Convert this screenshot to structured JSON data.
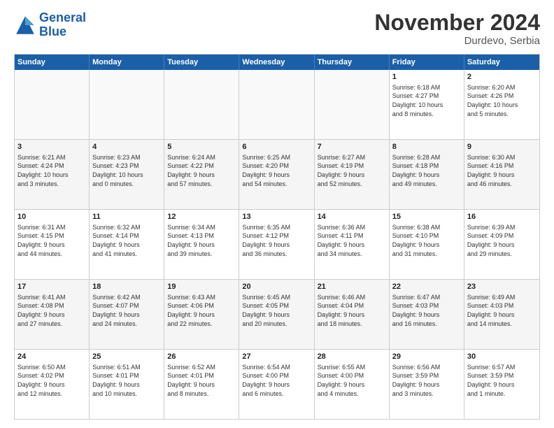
{
  "header": {
    "logo": {
      "line1": "General",
      "line2": "Blue"
    },
    "month": "November 2024",
    "location": "Durdevo, Serbia"
  },
  "weekdays": [
    "Sunday",
    "Monday",
    "Tuesday",
    "Wednesday",
    "Thursday",
    "Friday",
    "Saturday"
  ],
  "rows": [
    {
      "cells": [
        {
          "day": "",
          "info": "",
          "empty": true
        },
        {
          "day": "",
          "info": "",
          "empty": true
        },
        {
          "day": "",
          "info": "",
          "empty": true
        },
        {
          "day": "",
          "info": "",
          "empty": true
        },
        {
          "day": "",
          "info": "",
          "empty": true
        },
        {
          "day": "1",
          "info": "Sunrise: 6:18 AM\nSunset: 4:27 PM\nDaylight: 10 hours\nand 8 minutes.",
          "empty": false
        },
        {
          "day": "2",
          "info": "Sunrise: 6:20 AM\nSunset: 4:26 PM\nDaylight: 10 hours\nand 5 minutes.",
          "empty": false
        }
      ]
    },
    {
      "cells": [
        {
          "day": "3",
          "info": "Sunrise: 6:21 AM\nSunset: 4:24 PM\nDaylight: 10 hours\nand 3 minutes.",
          "empty": false
        },
        {
          "day": "4",
          "info": "Sunrise: 6:23 AM\nSunset: 4:23 PM\nDaylight: 10 hours\nand 0 minutes.",
          "empty": false
        },
        {
          "day": "5",
          "info": "Sunrise: 6:24 AM\nSunset: 4:22 PM\nDaylight: 9 hours\nand 57 minutes.",
          "empty": false
        },
        {
          "day": "6",
          "info": "Sunrise: 6:25 AM\nSunset: 4:20 PM\nDaylight: 9 hours\nand 54 minutes.",
          "empty": false
        },
        {
          "day": "7",
          "info": "Sunrise: 6:27 AM\nSunset: 4:19 PM\nDaylight: 9 hours\nand 52 minutes.",
          "empty": false
        },
        {
          "day": "8",
          "info": "Sunrise: 6:28 AM\nSunset: 4:18 PM\nDaylight: 9 hours\nand 49 minutes.",
          "empty": false
        },
        {
          "day": "9",
          "info": "Sunrise: 6:30 AM\nSunset: 4:16 PM\nDaylight: 9 hours\nand 46 minutes.",
          "empty": false
        }
      ]
    },
    {
      "cells": [
        {
          "day": "10",
          "info": "Sunrise: 6:31 AM\nSunset: 4:15 PM\nDaylight: 9 hours\nand 44 minutes.",
          "empty": false
        },
        {
          "day": "11",
          "info": "Sunrise: 6:32 AM\nSunset: 4:14 PM\nDaylight: 9 hours\nand 41 minutes.",
          "empty": false
        },
        {
          "day": "12",
          "info": "Sunrise: 6:34 AM\nSunset: 4:13 PM\nDaylight: 9 hours\nand 39 minutes.",
          "empty": false
        },
        {
          "day": "13",
          "info": "Sunrise: 6:35 AM\nSunset: 4:12 PM\nDaylight: 9 hours\nand 36 minutes.",
          "empty": false
        },
        {
          "day": "14",
          "info": "Sunrise: 6:36 AM\nSunset: 4:11 PM\nDaylight: 9 hours\nand 34 minutes.",
          "empty": false
        },
        {
          "day": "15",
          "info": "Sunrise: 6:38 AM\nSunset: 4:10 PM\nDaylight: 9 hours\nand 31 minutes.",
          "empty": false
        },
        {
          "day": "16",
          "info": "Sunrise: 6:39 AM\nSunset: 4:09 PM\nDaylight: 9 hours\nand 29 minutes.",
          "empty": false
        }
      ]
    },
    {
      "cells": [
        {
          "day": "17",
          "info": "Sunrise: 6:41 AM\nSunset: 4:08 PM\nDaylight: 9 hours\nand 27 minutes.",
          "empty": false
        },
        {
          "day": "18",
          "info": "Sunrise: 6:42 AM\nSunset: 4:07 PM\nDaylight: 9 hours\nand 24 minutes.",
          "empty": false
        },
        {
          "day": "19",
          "info": "Sunrise: 6:43 AM\nSunset: 4:06 PM\nDaylight: 9 hours\nand 22 minutes.",
          "empty": false
        },
        {
          "day": "20",
          "info": "Sunrise: 6:45 AM\nSunset: 4:05 PM\nDaylight: 9 hours\nand 20 minutes.",
          "empty": false
        },
        {
          "day": "21",
          "info": "Sunrise: 6:46 AM\nSunset: 4:04 PM\nDaylight: 9 hours\nand 18 minutes.",
          "empty": false
        },
        {
          "day": "22",
          "info": "Sunrise: 6:47 AM\nSunset: 4:03 PM\nDaylight: 9 hours\nand 16 minutes.",
          "empty": false
        },
        {
          "day": "23",
          "info": "Sunrise: 6:49 AM\nSunset: 4:03 PM\nDaylight: 9 hours\nand 14 minutes.",
          "empty": false
        }
      ]
    },
    {
      "cells": [
        {
          "day": "24",
          "info": "Sunrise: 6:50 AM\nSunset: 4:02 PM\nDaylight: 9 hours\nand 12 minutes.",
          "empty": false
        },
        {
          "day": "25",
          "info": "Sunrise: 6:51 AM\nSunset: 4:01 PM\nDaylight: 9 hours\nand 10 minutes.",
          "empty": false
        },
        {
          "day": "26",
          "info": "Sunrise: 6:52 AM\nSunset: 4:01 PM\nDaylight: 9 hours\nand 8 minutes.",
          "empty": false
        },
        {
          "day": "27",
          "info": "Sunrise: 6:54 AM\nSunset: 4:00 PM\nDaylight: 9 hours\nand 6 minutes.",
          "empty": false
        },
        {
          "day": "28",
          "info": "Sunrise: 6:55 AM\nSunset: 4:00 PM\nDaylight: 9 hours\nand 4 minutes.",
          "empty": false
        },
        {
          "day": "29",
          "info": "Sunrise: 6:56 AM\nSunset: 3:59 PM\nDaylight: 9 hours\nand 3 minutes.",
          "empty": false
        },
        {
          "day": "30",
          "info": "Sunrise: 6:57 AM\nSunset: 3:59 PM\nDaylight: 9 hours\nand 1 minute.",
          "empty": false
        }
      ]
    }
  ]
}
